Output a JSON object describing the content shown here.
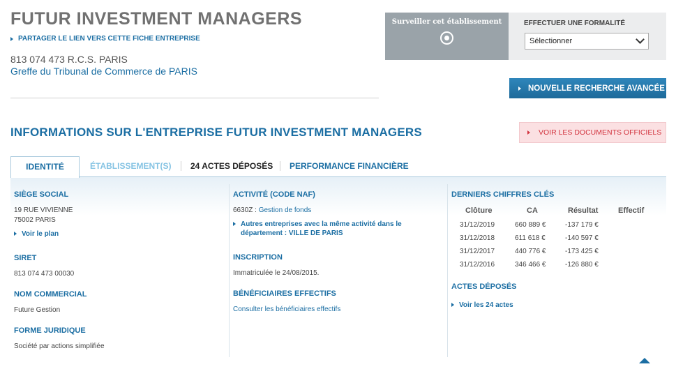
{
  "header": {
    "company_name": "FUTUR INVESTMENT MANAGERS",
    "share_link": "PARTAGER LE LIEN VERS CETTE FICHE ENTREPRISE",
    "rcs": "813 074 473  R.C.S. PARIS",
    "greffe": "Greffe du Tribunal de Commerce de PARIS"
  },
  "actions": {
    "surveiller_label": "Surveiller cet établissement",
    "formalite_label": "EFFECTUER UNE FORMALITÉ",
    "formalite_selected": "Sélectionner",
    "nouvelle_recherche": "NOUVELLE RECHERCHE AVANCÉE",
    "voir_documents": "VOIR LES DOCUMENTS OFFICIELS"
  },
  "section_title": "INFORMATIONS SUR L'ENTREPRISE FUTUR INVESTMENT MANAGERS",
  "tabs": {
    "identite": "IDENTITÉ",
    "etablissements": "ÉTABLISSEMENT(S)",
    "actes_count": "24",
    "actes": "ACTES DÉPOSÉS",
    "performance": "PERFORMANCE FINANCIÈRE"
  },
  "identity": {
    "siege_title": "SIÈGE SOCIAL",
    "address_line1": "19 RUE VIVIENNE",
    "address_line2": "75002 PARIS",
    "voir_plan": "Voir le plan",
    "siret_title": "SIRET",
    "siret": "813 074 473 00030",
    "nom_commercial_title": "NOM COMMERCIAL",
    "nom_commercial": "Future Gestion",
    "forme_title": "FORME JURIDIQUE",
    "forme": "Société par actions simplifiée"
  },
  "activity": {
    "title": "ACTIVITÉ (CODE NAF)",
    "code": "6630Z :",
    "label": "Gestion de fonds",
    "others_line1": "Autres entreprises avec la même activité dans le",
    "others_line2": "département : VILLE DE PARIS",
    "inscription_title": "INSCRIPTION",
    "inscription": "Immatriculée le 24/08/2015.",
    "beneficiaires_title": "BÉNÉFICIAIRES EFFECTIFS",
    "beneficiaires_link": "Consulter les bénéficiaires effectifs"
  },
  "financials": {
    "title": "DERNIERS CHIFFRES CLÉS",
    "headers": [
      "Clôture",
      "CA",
      "Résultat",
      "Effectif"
    ],
    "rows": [
      [
        "31/12/2019",
        "660 889 €",
        "-137 179 €",
        ""
      ],
      [
        "31/12/2018",
        "611 618 €",
        "-140 597 €",
        ""
      ],
      [
        "31/12/2017",
        "440 776 €",
        "-173 425 €",
        ""
      ],
      [
        "31/12/2016",
        "346 466 €",
        "-126 880 €",
        ""
      ]
    ],
    "actes_title": "ACTES DÉPOSÉS",
    "actes_link": "Voir les 24 actes"
  }
}
